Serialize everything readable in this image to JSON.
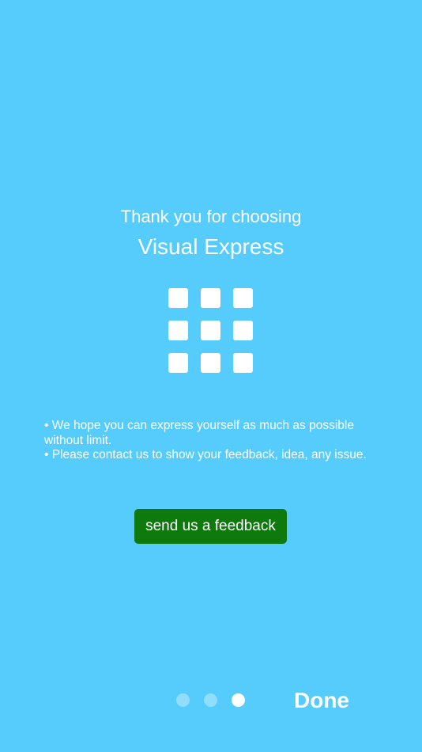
{
  "intro": {
    "greeting": "Thank you for choosing",
    "app_name": "Visual Express"
  },
  "icon": {
    "name": "grid-icon",
    "rows": 3,
    "columns": 3
  },
  "notes": [
    "• We hope you can express yourself as much as possible without limit.",
    "• Please contact us to show your feedback, idea, any issue."
  ],
  "feedback_button": {
    "label": "send us a feedback"
  },
  "pager": {
    "page_count": 3,
    "current_page": 3
  },
  "done_button": {
    "label": "Done"
  },
  "colors": {
    "background": "#55CCFB",
    "button": "#0E7A0D",
    "text": "#FFFFFF"
  }
}
